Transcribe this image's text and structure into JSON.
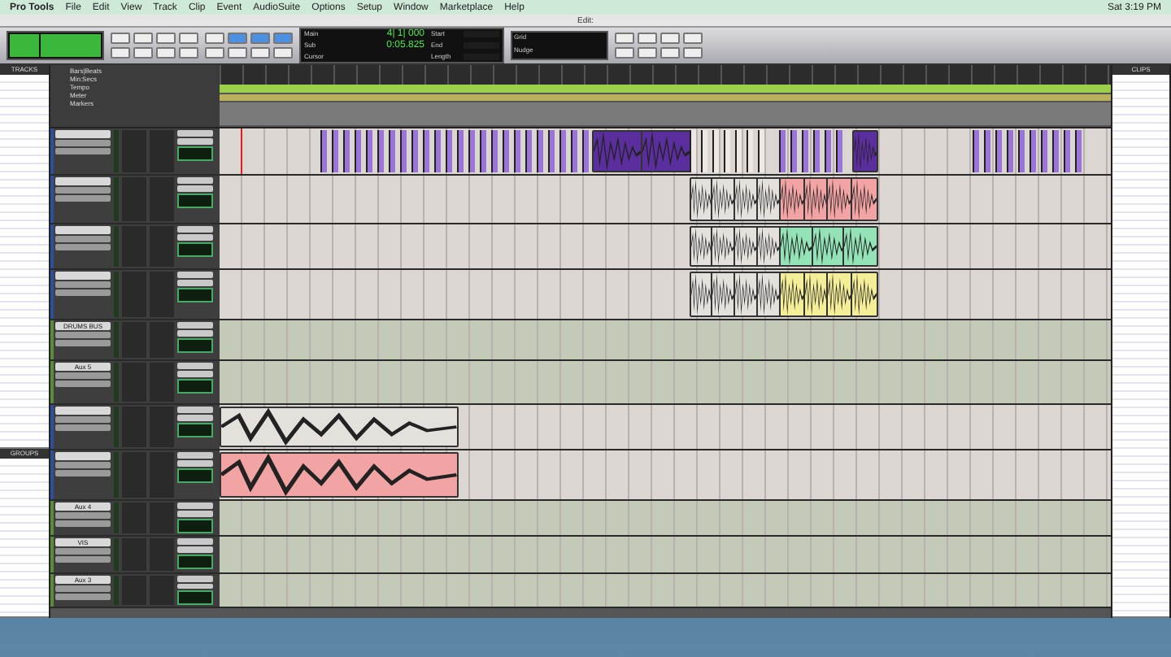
{
  "menu_bar": {
    "app": "Pro Tools",
    "items": [
      "File",
      "Edit",
      "View",
      "Track",
      "Clip",
      "Event",
      "AudioSuite",
      "Options",
      "Setup",
      "Window",
      "Marketplace",
      "Help"
    ],
    "clock": "Sat 3:19 PM"
  },
  "window": {
    "title": "Edit:"
  },
  "counters": {
    "main_label": "Main",
    "main": "4| 1| 000",
    "sub_label": "Sub",
    "sub": "0:05.825",
    "start_label": "Start",
    "end_label": "End",
    "length_label": "Length",
    "cursor_label": "Cursor",
    "grid_label": "Grid",
    "nudge_label": "Nudge"
  },
  "tracks_panel": {
    "title": "TRACKS"
  },
  "groups_panel": {
    "title": "GROUPS"
  },
  "clips_panel": {
    "title": "CLIPS"
  },
  "rulers": [
    "Bars|Beats",
    "Min:Secs",
    "Tempo",
    "Meter",
    "Markers"
  ],
  "tracks": [
    {
      "kind": "audio",
      "clips": [
        {
          "kind": "hits",
          "color": "#9b74d8"
        },
        {
          "kind": "block",
          "color": "#5b2e9e"
        },
        {
          "kind": "hits",
          "color": "#ece8e4"
        },
        {
          "kind": "hits",
          "color": "#9b74d8"
        },
        {
          "kind": "block",
          "color": "#5b2e9e"
        },
        {
          "kind": "hits",
          "color": "#9b74d8"
        }
      ]
    },
    {
      "kind": "audio",
      "clips": [
        {
          "kind": "block",
          "color": "#e4e0dc"
        },
        {
          "kind": "block",
          "color": "#f2a3a3"
        }
      ]
    },
    {
      "kind": "audio",
      "clips": [
        {
          "kind": "block",
          "color": "#e4e0dc"
        },
        {
          "kind": "block",
          "color": "#93e3b6"
        }
      ]
    },
    {
      "kind": "audio",
      "clips": [
        {
          "kind": "block",
          "color": "#e4e0dc"
        },
        {
          "kind": "block",
          "color": "#f4ee98"
        }
      ]
    },
    {
      "kind": "aux",
      "name": "DRUMS BUS"
    },
    {
      "kind": "aux",
      "name": "Aux 5"
    },
    {
      "kind": "audio",
      "clips": [
        {
          "kind": "block",
          "color": "#e4e0dc"
        }
      ]
    },
    {
      "kind": "audio",
      "clips": [
        {
          "kind": "block",
          "color": "#f2a3a3"
        }
      ]
    },
    {
      "kind": "aux",
      "name": "Aux 4"
    },
    {
      "kind": "aux",
      "name": "VIS"
    },
    {
      "kind": "aux",
      "name": "Aux 3"
    }
  ]
}
